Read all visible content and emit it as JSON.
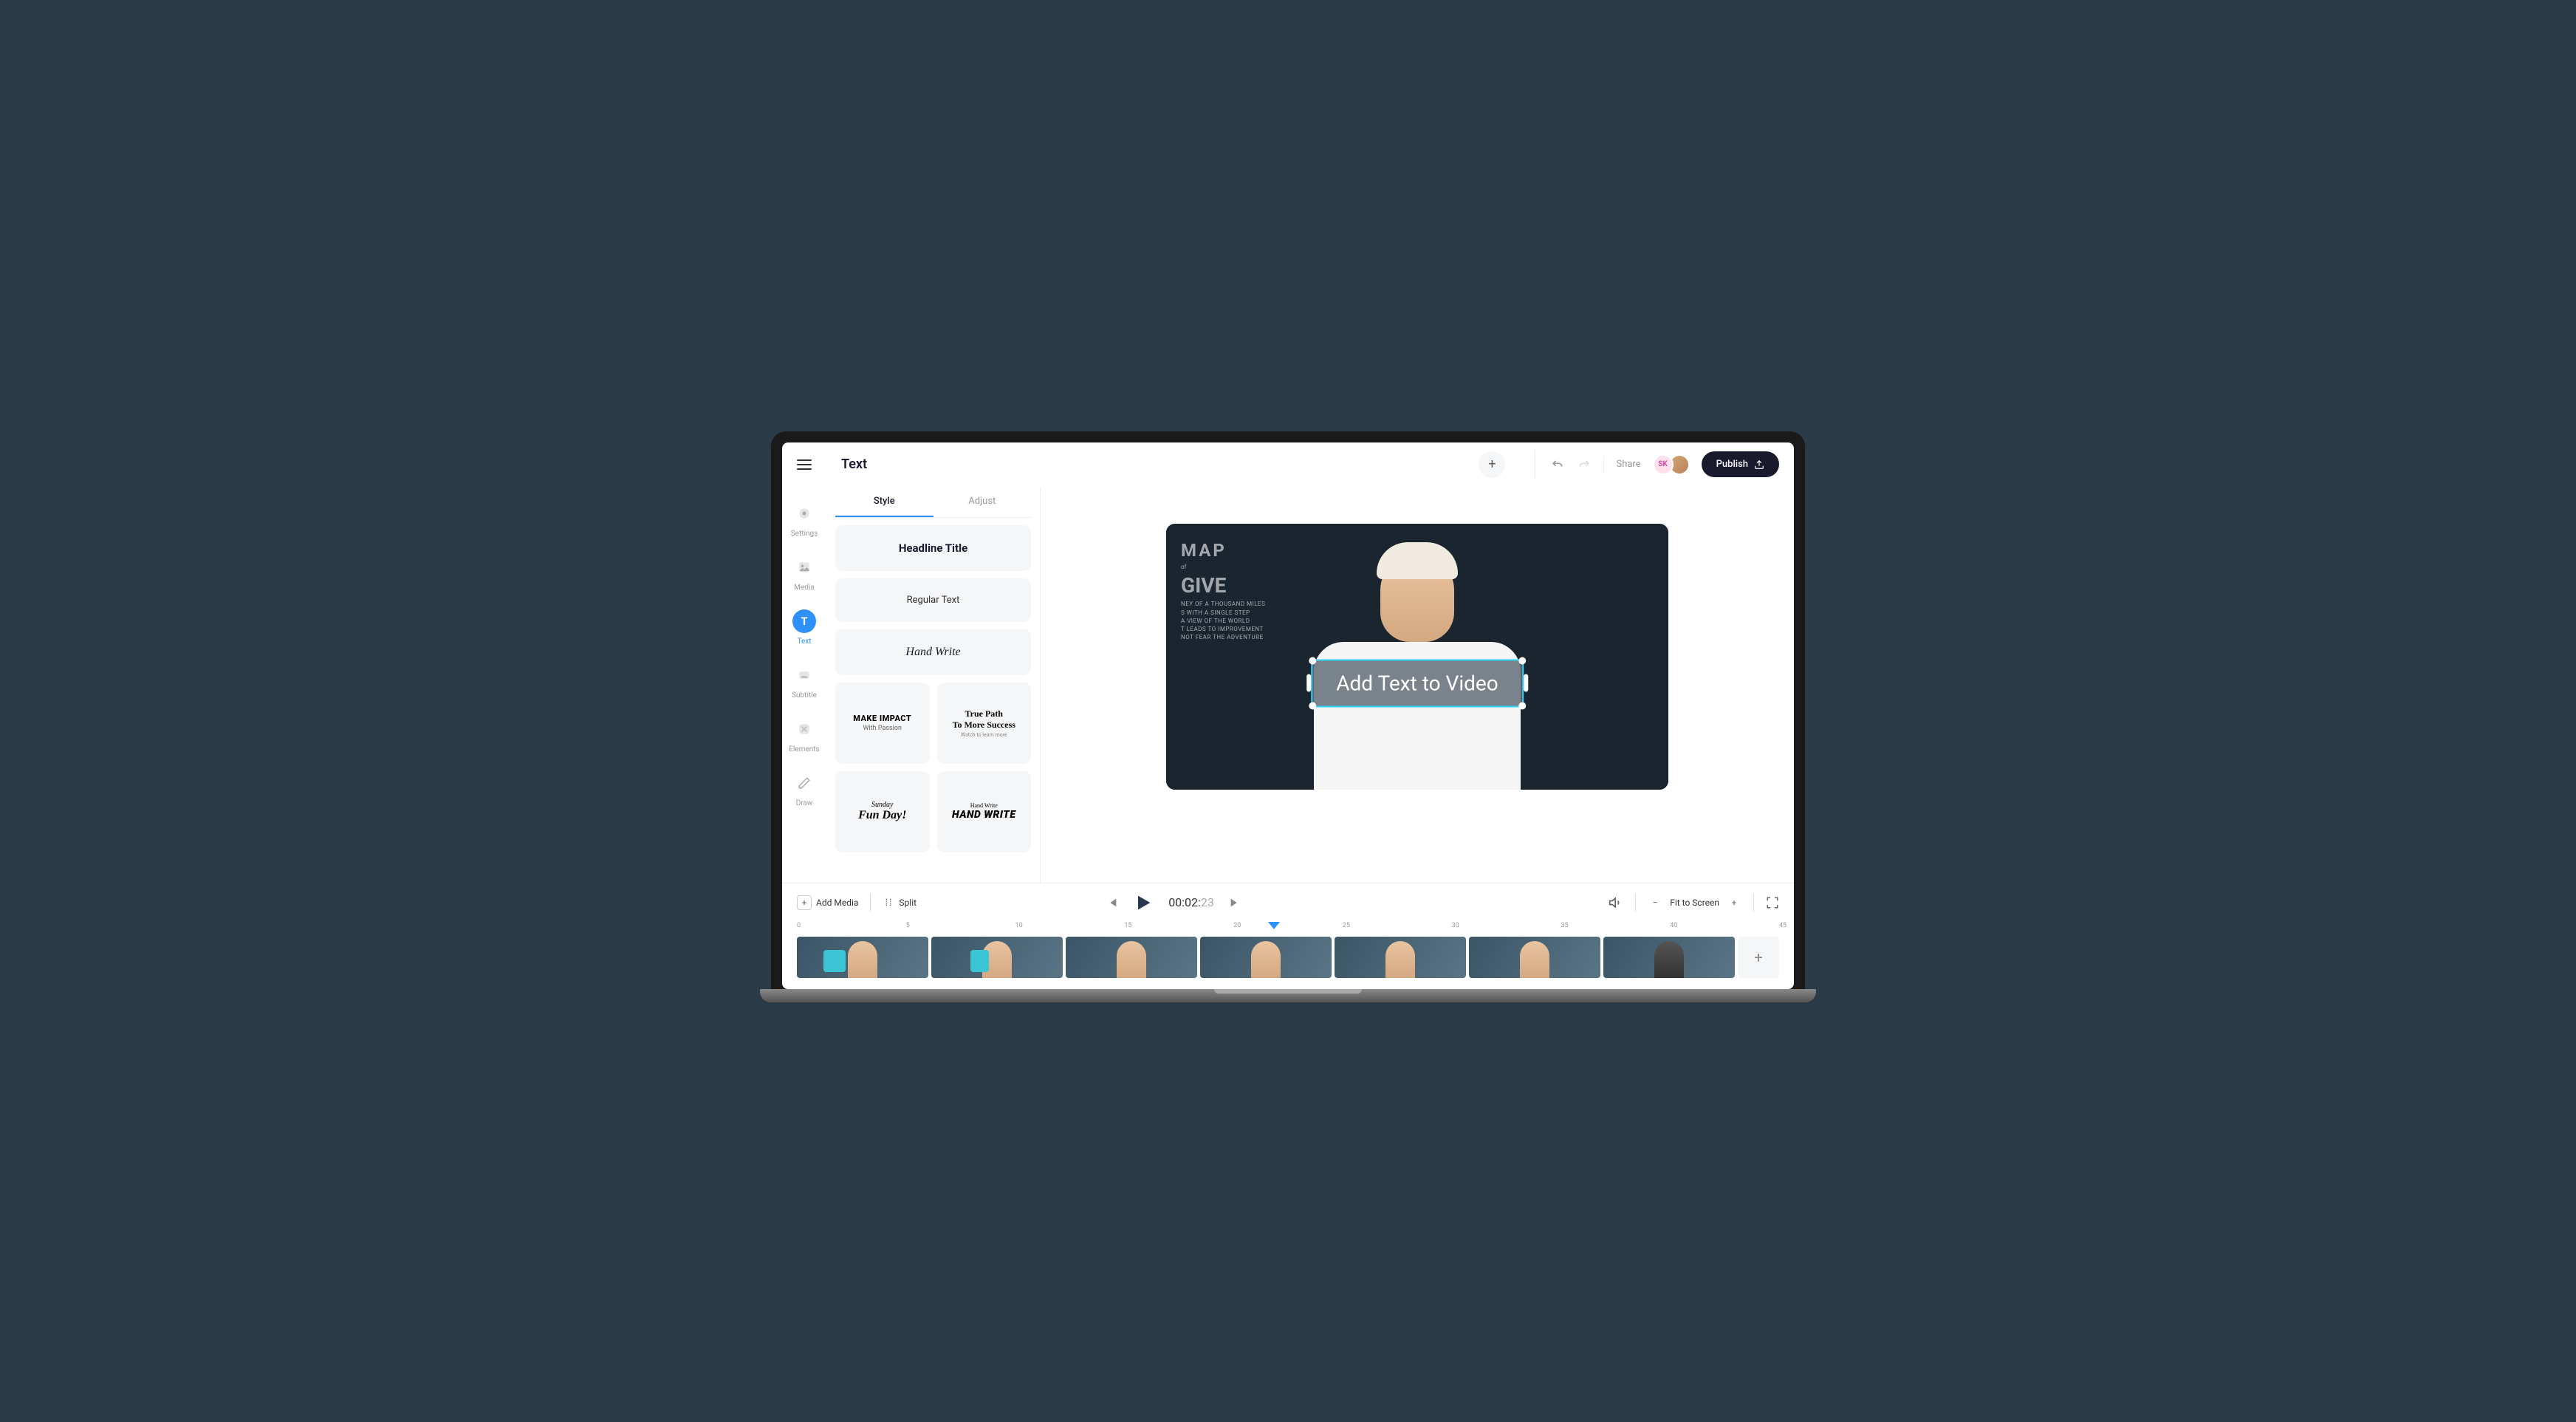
{
  "header": {
    "panel_title": "Text",
    "share": "Share",
    "avatar_initials": "SK",
    "publish": "Publish"
  },
  "rail": {
    "settings": "Settings",
    "media": "Media",
    "text": "Text",
    "subtitle": "Subtitle",
    "elements": "Elements",
    "draw": "Draw"
  },
  "text_panel": {
    "tab_style": "Style",
    "tab_adjust": "Adjust",
    "styles": {
      "headline": "Headline Title",
      "regular": "Regular Text",
      "handwrite": "Hand Write",
      "make_impact_1": "MAKE IMPACT",
      "make_impact_2": "With Passion",
      "truepath_1": "True Path",
      "truepath_2": "To More Success",
      "truepath_3": "Watch to learn more",
      "sunday_1": "Sunday",
      "sunday_2": "Fun Day!",
      "hw_1": "Hand Write",
      "hw_2": "HAND WRITE"
    }
  },
  "canvas": {
    "overlay_text": "Add Text to Video",
    "chalk_map": "MAP",
    "chalk_give": "GIVE",
    "chalk_lines": "NEY OF A THOUSAND MILES\nS WITH A SINGLE STEP\na VIEW of the WORLD\nT LEADS TO IMPROVEMENT\nNot Fear The Adventure"
  },
  "controls": {
    "add_media": "Add Media",
    "split": "Split",
    "timecode_main": "00:02:",
    "timecode_frames": "23",
    "fit_to_screen": "Fit to Screen"
  },
  "timeline": {
    "marks": [
      "0",
      "5",
      "10",
      "15",
      "20",
      "25",
      "30",
      "35",
      "40",
      "45"
    ],
    "playhead_position_pct": 48
  }
}
